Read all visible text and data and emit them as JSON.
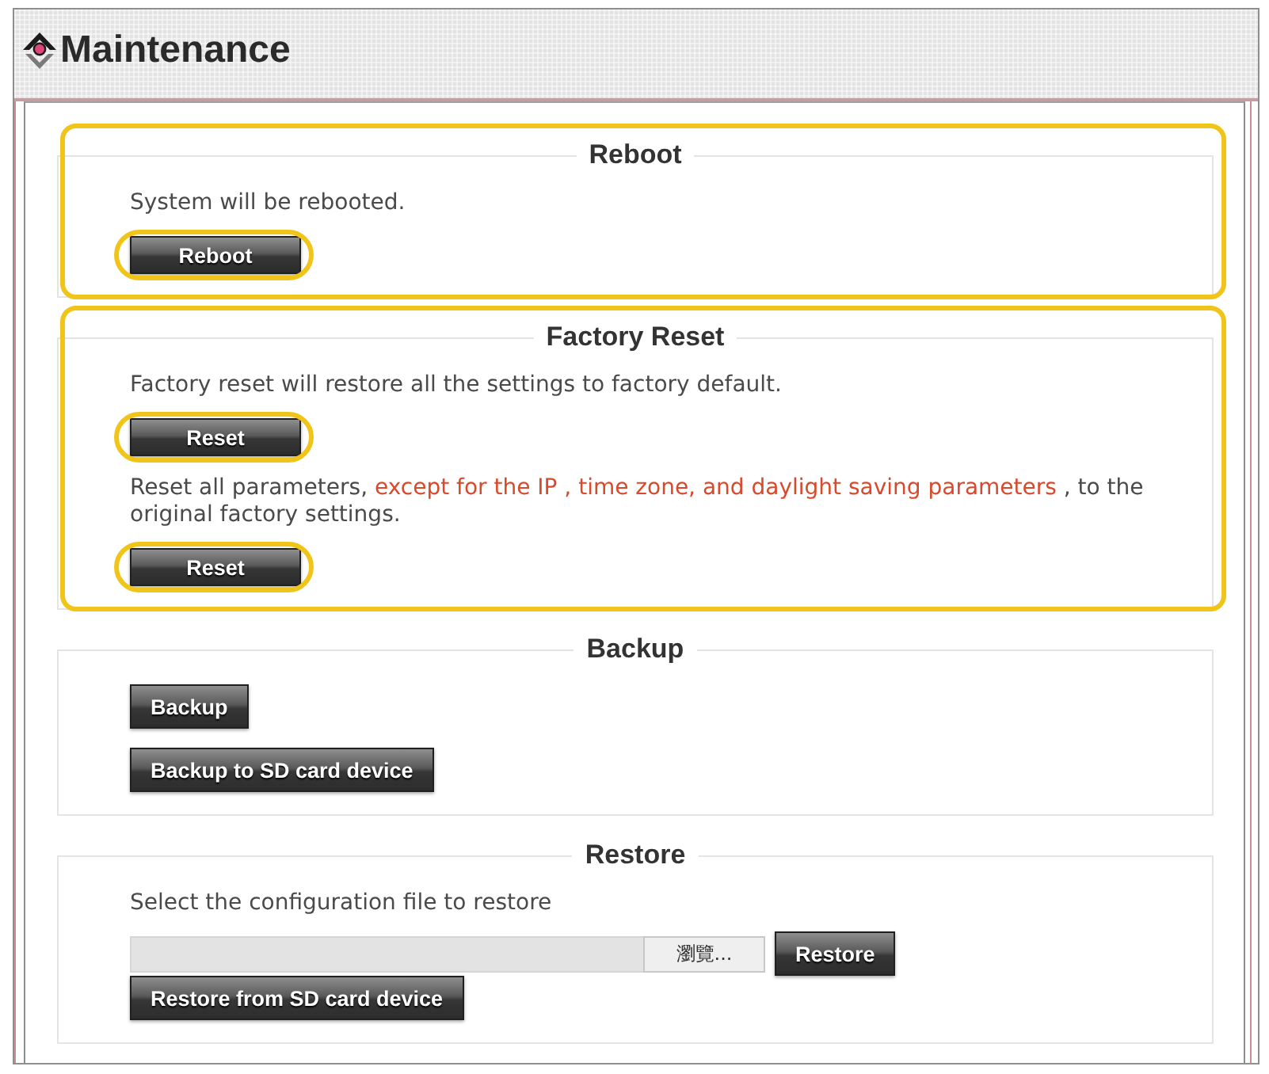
{
  "window": {
    "title": "Maintenance"
  },
  "sections": [
    {
      "legend": "Reboot",
      "highlighted": true,
      "items": [
        {
          "kind": "text",
          "text": "System will be rebooted."
        },
        {
          "kind": "button",
          "label": "Reboot",
          "highlighted": true
        }
      ]
    },
    {
      "legend": "Factory Reset",
      "highlighted": true,
      "items": [
        {
          "kind": "text",
          "text": "Factory reset will restore all the settings to factory default."
        },
        {
          "kind": "button",
          "label": "Reset",
          "highlighted": true
        },
        {
          "kind": "paragraph",
          "parts": [
            {
              "text": "Reset all parameters, ",
              "warning": false
            },
            {
              "text": "except for the IP , time zone, and daylight saving parameters",
              "warning": true
            },
            {
              "text": " , to the original factory settings.",
              "warning": false
            }
          ]
        },
        {
          "kind": "button",
          "label": "Reset",
          "highlighted": true
        }
      ]
    },
    {
      "legend": "Backup",
      "highlighted": false,
      "items": [
        {
          "kind": "button",
          "label": "Backup",
          "highlighted": false
        },
        {
          "kind": "button",
          "label": "Backup to SD card device",
          "highlighted": false
        }
      ]
    },
    {
      "legend": "Restore",
      "highlighted": false,
      "items": [
        {
          "kind": "text",
          "text": "Select the configuration file to restore"
        },
        {
          "kind": "file-picker",
          "browse_label": "瀏覽...",
          "button": {
            "label": "Restore",
            "highlighted": false
          }
        },
        {
          "kind": "button",
          "label": "Restore from SD card device",
          "highlighted": false
        }
      ]
    }
  ]
}
